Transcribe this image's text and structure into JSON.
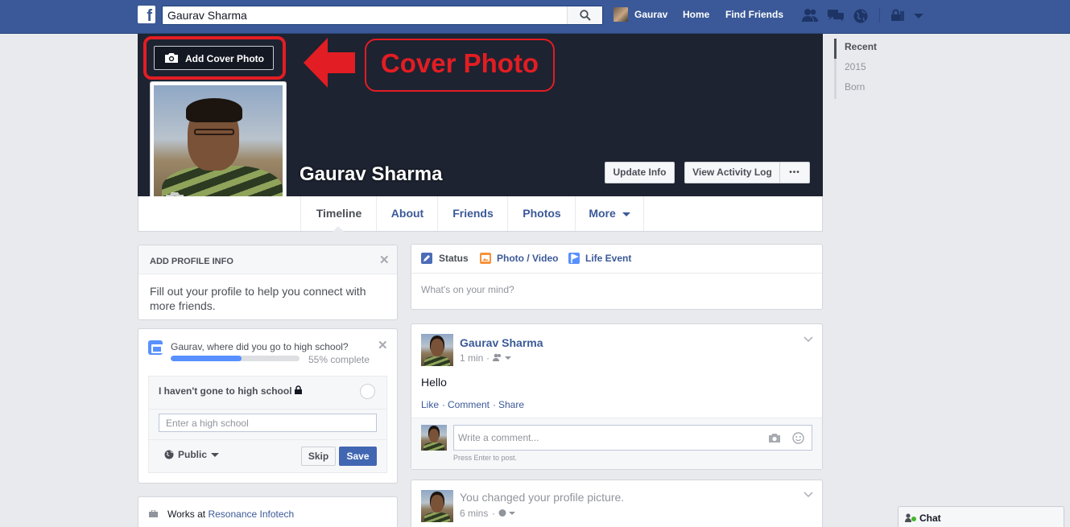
{
  "topbar": {
    "logo_letter": "f",
    "search_value": "Gaurav Sharma",
    "user_name": "Gaurav",
    "home": "Home",
    "find_friends": "Find Friends"
  },
  "cover": {
    "add_cover_label": "Add Cover Photo",
    "annotation_text": "Cover Photo",
    "profile_name": "Gaurav Sharma",
    "update_info": "Update Info",
    "view_activity_log": "View Activity Log",
    "more_dots": "•••"
  },
  "tabs": {
    "timeline": "Timeline",
    "about": "About",
    "friends": "Friends",
    "photos": "Photos",
    "more": "More"
  },
  "year_nav": [
    "Recent",
    "2015",
    "Born"
  ],
  "add_profile_info": {
    "heading": "ADD PROFILE INFO",
    "body": "Fill out your profile to help you connect with more friends."
  },
  "high_school": {
    "question": "Gaurav, where did you go to high school?",
    "progress_percent": 55,
    "progress_text": "55% complete",
    "no_school_label": "I haven't gone to high school",
    "input_placeholder": "Enter a high school",
    "privacy": "Public",
    "skip": "Skip",
    "save": "Save"
  },
  "works_at": {
    "prefix": "Works at",
    "company": "Resonance Infotech"
  },
  "composer": {
    "status": "Status",
    "photo_video": "Photo / Video",
    "life_event": "Life Event",
    "placeholder": "What's on your mind?"
  },
  "post1": {
    "author": "Gaurav Sharma",
    "time": "1 min",
    "sep": "·",
    "body": "Hello",
    "like": "Like",
    "comment": "Comment",
    "share": "Share",
    "comment_placeholder": "Write a comment...",
    "press_enter": "Press Enter to post."
  },
  "post2": {
    "text": "You changed your profile picture.",
    "time": "6 mins",
    "sep": "·"
  },
  "chat": {
    "label": "Chat"
  },
  "colors": {
    "brand": "#3b5998",
    "annotation_red": "#e21d23",
    "cover_bg": "#1d2331",
    "progress_blue": "#5890ff",
    "save_blue": "#4267b2",
    "online_green": "#42b72a"
  }
}
